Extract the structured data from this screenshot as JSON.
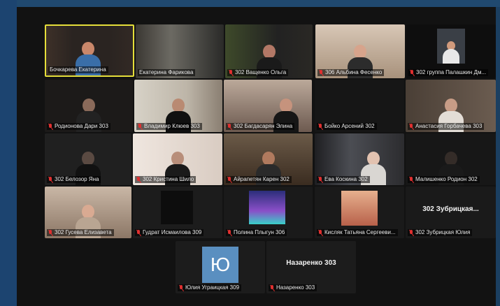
{
  "participants": [
    {
      "name": "Бочкарева Екатерина",
      "muted": false,
      "active": true
    },
    {
      "name": "Екатерина Фарикова",
      "muted": false
    },
    {
      "name": "302 Ващенко Ольга",
      "muted": true
    },
    {
      "name": "306 Альбина Фесенко",
      "muted": true
    },
    {
      "name": "302 группа Палашкин Дм...",
      "muted": true
    },
    {
      "name": "Родионова Дари 303",
      "muted": true
    },
    {
      "name": "Владимир Клюев 303",
      "muted": true
    },
    {
      "name": "302 Багдасарян Элина",
      "muted": true
    },
    {
      "name": "Бойко Арсений 302",
      "muted": true
    },
    {
      "name": "Анастасия Горбачева 303",
      "muted": true
    },
    {
      "name": "302 Белозор Яна",
      "muted": true
    },
    {
      "name": "302 Кристина Шило",
      "muted": true
    },
    {
      "name": "Айрапетян Карен 302",
      "muted": true
    },
    {
      "name": "Ева Коскина 302",
      "muted": true
    },
    {
      "name": "Малишенко Родион 302",
      "muted": true
    },
    {
      "name": "302 Гусева Елизавета",
      "muted": true
    },
    {
      "name": "Гудрат Исмаилова 309",
      "muted": true
    },
    {
      "name": "Полина Плыгун 306",
      "muted": true
    },
    {
      "name": "Кисляк Татьяна Сергееви...",
      "muted": true
    },
    {
      "name": "302 Зубрицкая Юлия",
      "muted": true,
      "video_label": "302 Зубрицкая..."
    },
    {
      "name": "Юлия Уграицкая 309",
      "muted": true,
      "avatar_letter": "Ю"
    },
    {
      "name": "Назаренко 303",
      "muted": true,
      "video_label": "Назаренко 303"
    }
  ],
  "colors": {
    "active_border": "#e5de3a",
    "mute_red": "#e03030",
    "avatar_blue": "#5a8fc0"
  }
}
